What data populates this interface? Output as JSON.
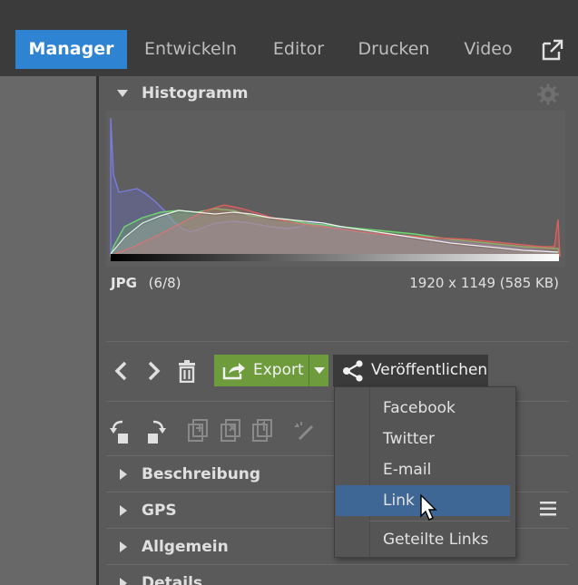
{
  "tabs": [
    {
      "label": "Manager",
      "active": true
    },
    {
      "label": "Entwickeln",
      "active": false
    },
    {
      "label": "Editor",
      "active": false
    },
    {
      "label": "Drucken",
      "active": false
    },
    {
      "label": "Video",
      "active": false
    }
  ],
  "histogram": {
    "title": "Histogramm",
    "file_type": "JPG",
    "position": "(6/8)",
    "dimensions": "1920 x 1149 (585 KB)"
  },
  "toolbar": {
    "export_label": "Export",
    "publish_label": "Veröffentlichen"
  },
  "publish_menu": {
    "items": [
      "Facebook",
      "Twitter",
      "E-mail",
      "Link"
    ],
    "highlighted": "Link",
    "footer_item": "Geteilte Links"
  },
  "sections": [
    "Beschreibung",
    "GPS",
    "Allgemein",
    "Details"
  ],
  "colors": {
    "accent": "#2e83d3",
    "export_green": "#6e9b3c",
    "menu_highlight": "#3e6796"
  }
}
